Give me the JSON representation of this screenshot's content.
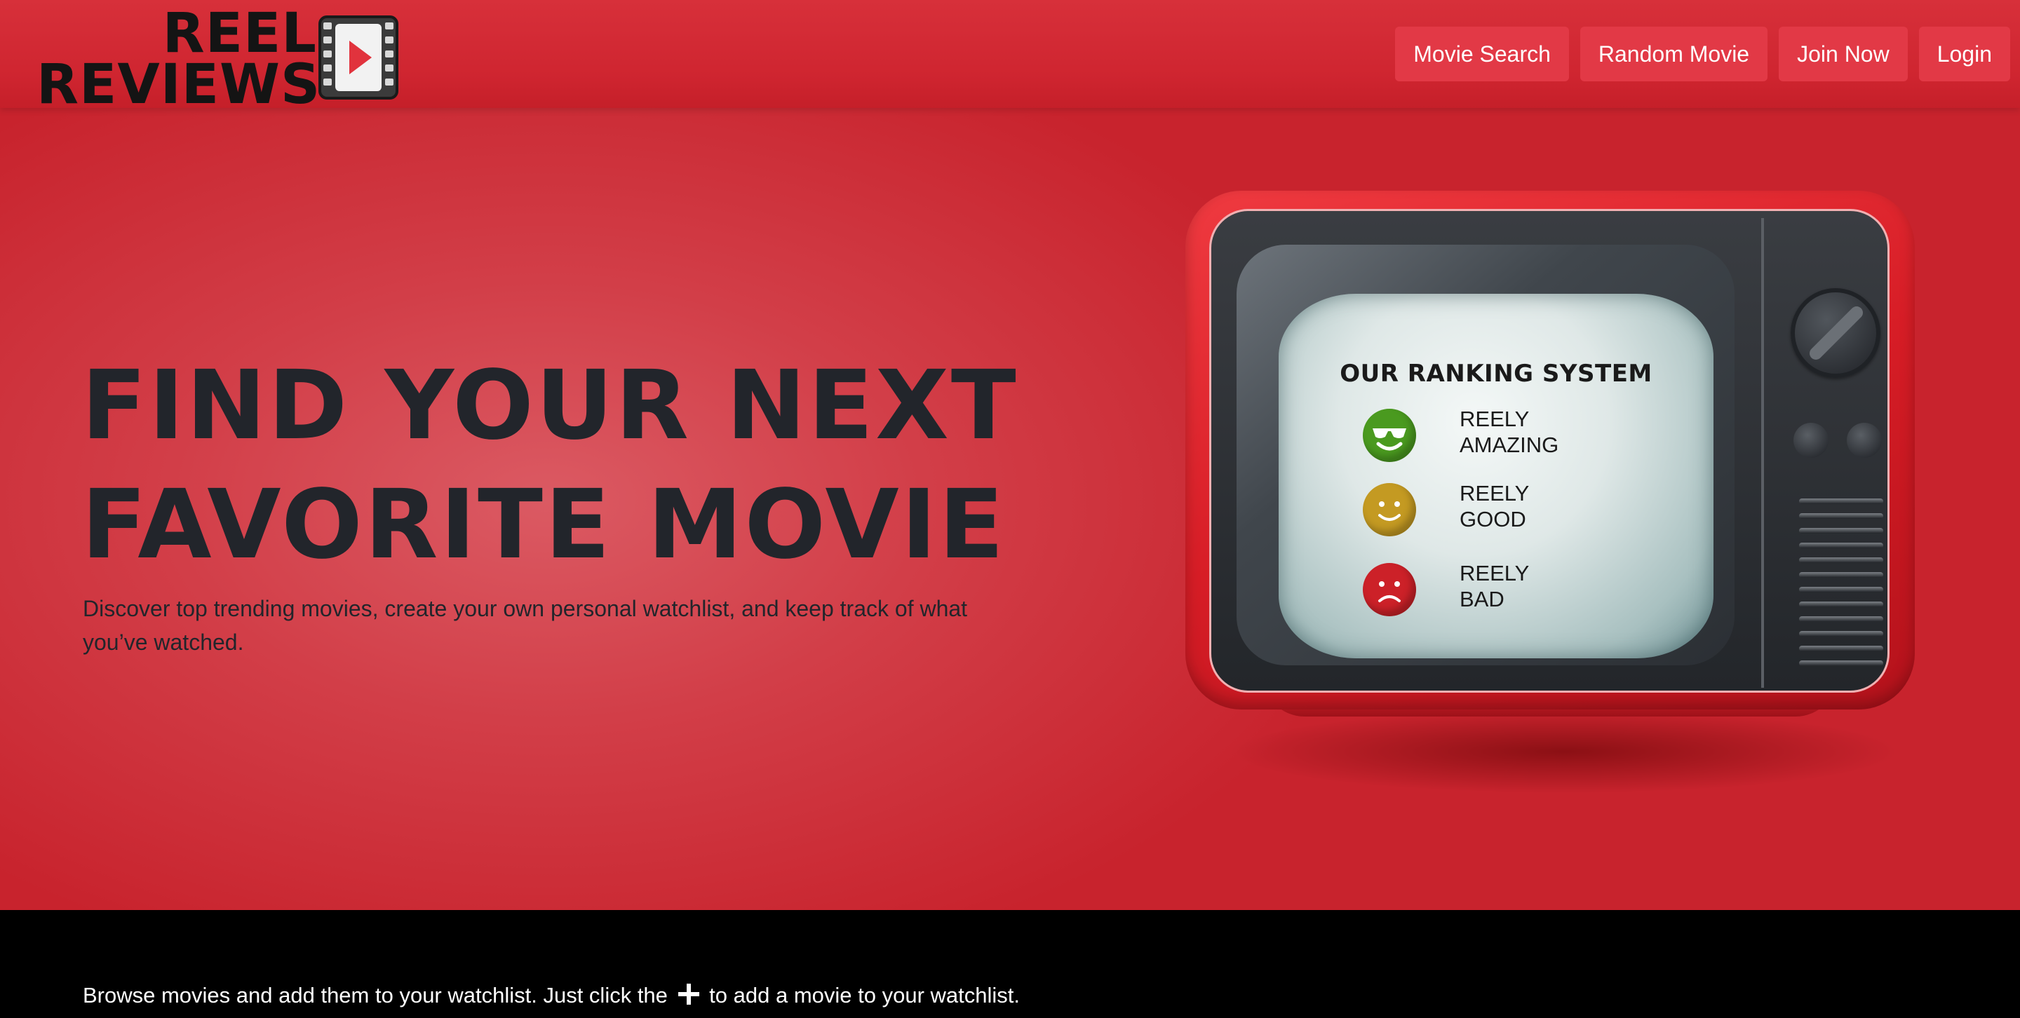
{
  "logo": {
    "line1": "REEL",
    "line2": "REVIEWS",
    "icon": "film-play-icon"
  },
  "nav": {
    "items": [
      {
        "label": "Movie Search"
      },
      {
        "label": "Random Movie"
      },
      {
        "label": "Join Now"
      },
      {
        "label": "Login"
      }
    ]
  },
  "hero": {
    "title_line1": "FIND YOUR NEXT",
    "title_line2": "FAVORITE MOVIE",
    "subtitle": "Discover top trending movies, create your own personal watchlist, and keep track of what you’ve watched."
  },
  "tv": {
    "screen_title": "OUR RANKING SYSTEM",
    "rankings": [
      {
        "label_line1": "REELY",
        "label_line2": "AMAZING",
        "icon": "cool-face-icon",
        "color": "#4a9a1f"
      },
      {
        "label_line1": "REELY",
        "label_line2": "GOOD",
        "icon": "smile-face-icon",
        "color": "#c49a22"
      },
      {
        "label_line1": "REELY",
        "label_line2": "BAD",
        "icon": "sad-face-icon",
        "color": "#cc2128"
      }
    ]
  },
  "browse": {
    "text_before": "Browse movies and add them to your watchlist. Just click the",
    "text_after": "to add a movie to your watchlist.",
    "icon": "plus-icon"
  },
  "colors": {
    "brand_red": "#d12a34",
    "nav_button": "#e23946",
    "title_text": "#22252b",
    "footer_bg": "#000000"
  }
}
